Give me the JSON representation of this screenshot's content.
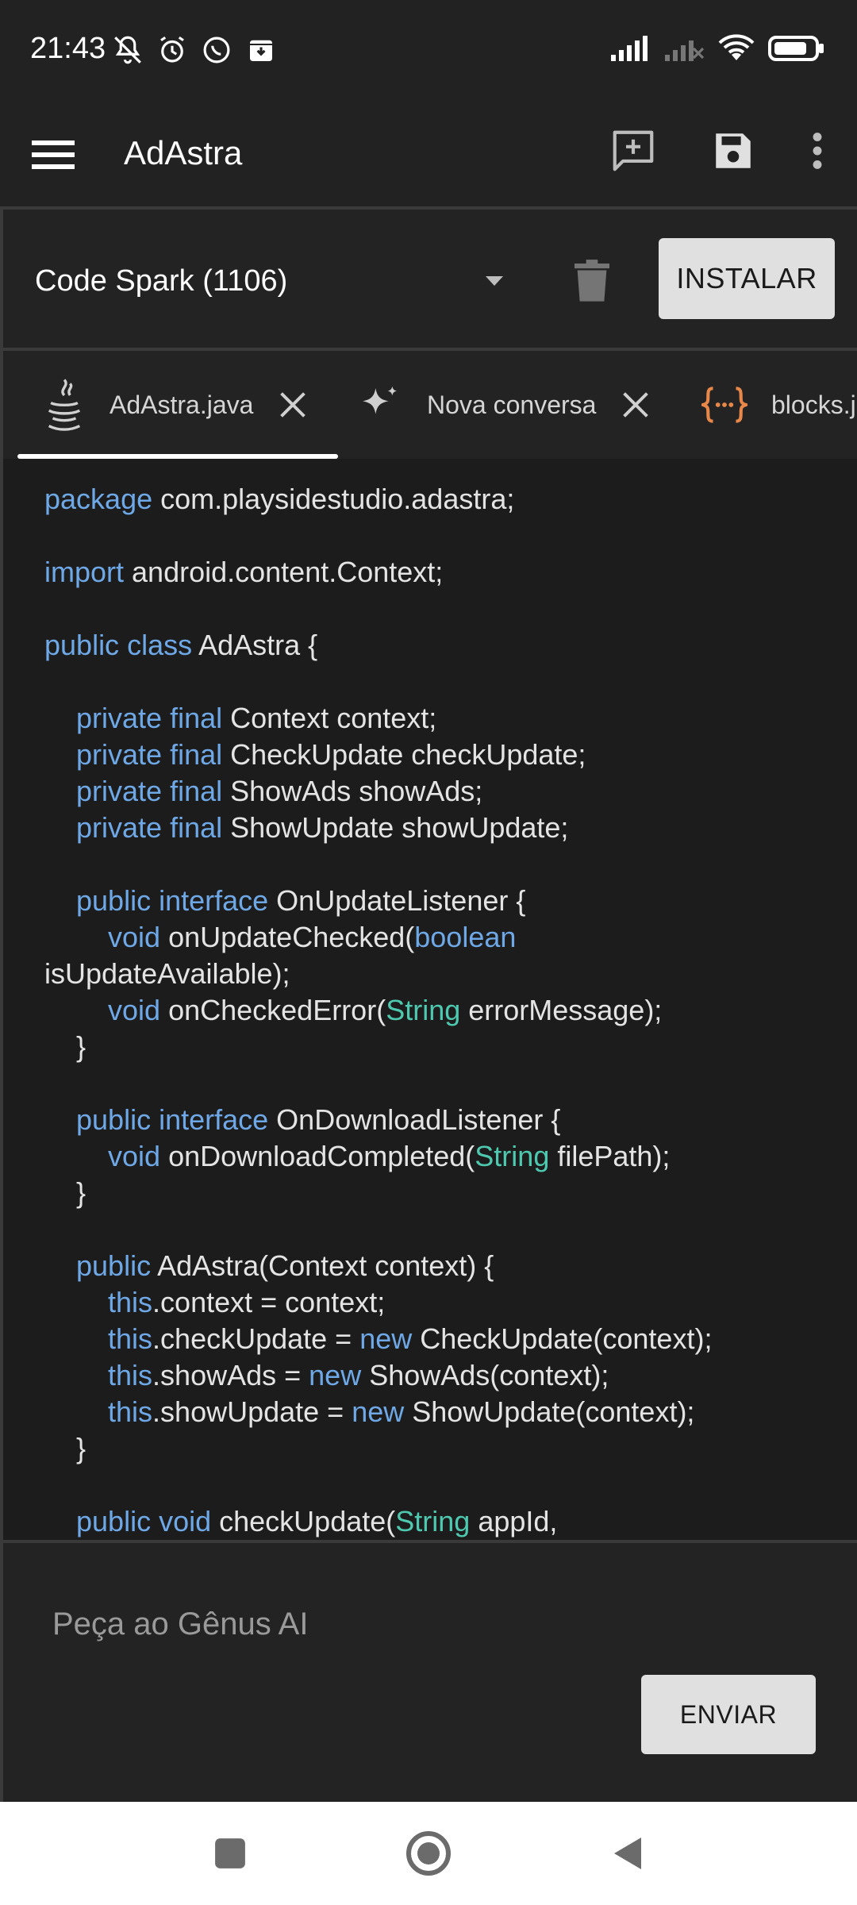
{
  "status_bar": {
    "time": "21:43",
    "left_icons": [
      "muted-bell-icon",
      "alarm-icon",
      "whatsapp-icon",
      "archive-notification-icon"
    ],
    "right_icons": [
      "signal-icon",
      "signal-off-icon",
      "wifi-icon",
      "battery-icon"
    ]
  },
  "app_bar": {
    "title": "AdAstra",
    "actions": [
      "add-comment-icon",
      "save-icon",
      "more-vert-icon"
    ]
  },
  "project": {
    "selected": "Code Spark (1106)",
    "install_label": "INSTALAR"
  },
  "tabs": [
    {
      "label": "AdAstra.java",
      "icon": "java-icon",
      "active": true
    },
    {
      "label": "Nova conversa",
      "icon": "sparkle-icon",
      "active": false
    },
    {
      "label": "blocks.j",
      "icon": "json-braces-icon",
      "active": false
    }
  ],
  "code_lines": [
    "package com.playsidestudio.adastra;",
    "",
    "import android.content.Context;",
    "",
    "public class AdAstra {",
    "",
    "    private final Context context;",
    "    private final CheckUpdate checkUpdate;",
    "    private final ShowAds showAds;",
    "    private final ShowUpdate showUpdate;",
    "",
    "    public interface OnUpdateListener {",
    "        void onUpdateChecked(boolean",
    "isUpdateAvailable);",
    "        void onCheckedError(String errorMessage);",
    "    }",
    "",
    "    public interface OnDownloadListener {",
    "        void onDownloadCompleted(String filePath);",
    "    }",
    "",
    "    public AdAstra(Context context) {",
    "        this.context = context;",
    "        this.checkUpdate = new CheckUpdate(context);",
    "        this.showAds = new ShowAds(context);",
    "        this.showUpdate = new ShowUpdate(context);",
    "    }",
    "",
    "    public void checkUpdate(String appId,"
  ],
  "chat": {
    "placeholder": "Peça ao Gênus AI",
    "send_label": "ENVIAR"
  },
  "colors": {
    "keyword": "#6fa8e6",
    "type": "#4ec9b0",
    "background": "#1c1c1c"
  }
}
